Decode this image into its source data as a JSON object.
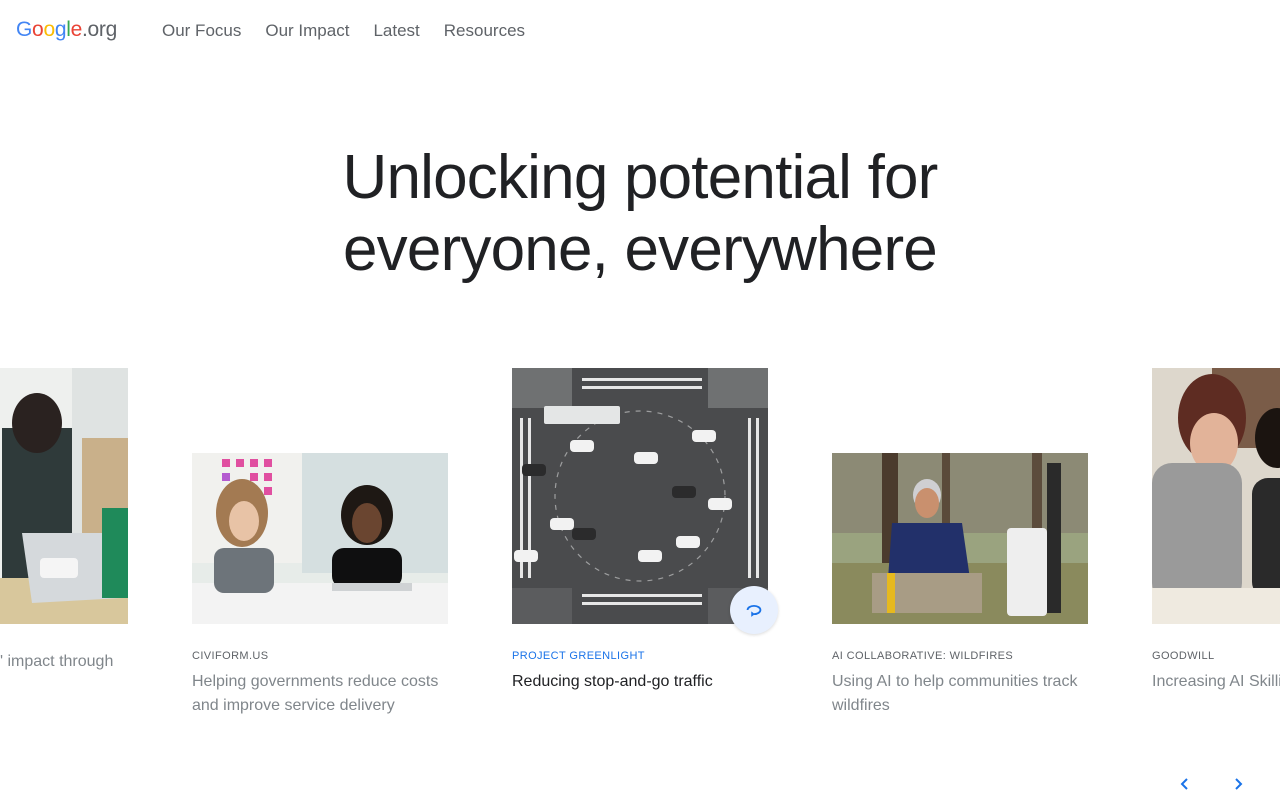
{
  "brand": {
    "logo_letters": [
      "G",
      "o",
      "o",
      "g",
      "l",
      "e"
    ],
    "logo_suffix": ".org",
    "logo_colors": [
      "#4285F4",
      "#EA4335",
      "#FBBC05",
      "#4285F4",
      "#34A853",
      "#EA4335"
    ]
  },
  "nav": {
    "items": [
      {
        "label": "Our Focus"
      },
      {
        "label": "Our Impact"
      },
      {
        "label": "Latest"
      },
      {
        "label": "Resources"
      }
    ]
  },
  "hero": {
    "line1": "Unlocking potential for",
    "line2": "everyone, everywhere"
  },
  "carousel": {
    "accent_color": "#1a73e8",
    "cards": [
      {
        "eyebrow": "",
        "title": "' impact through"
      },
      {
        "eyebrow": "CIVIFORM.US",
        "title": "Helping governments reduce costs and improve service delivery"
      },
      {
        "eyebrow": "PROJECT GREENLIGHT",
        "title": "Reducing stop-and-go traffic",
        "active": true
      },
      {
        "eyebrow": "AI COLLABORATIVE: WILDFIRES",
        "title": "Using AI to help communities track wildfires"
      },
      {
        "eyebrow": "GOODWILL",
        "title": "Increasing AI Skilli in rural areas"
      }
    ],
    "play_icon": "replay-icon",
    "prev_icon": "chevron-left-icon",
    "next_icon": "chevron-right-icon"
  }
}
